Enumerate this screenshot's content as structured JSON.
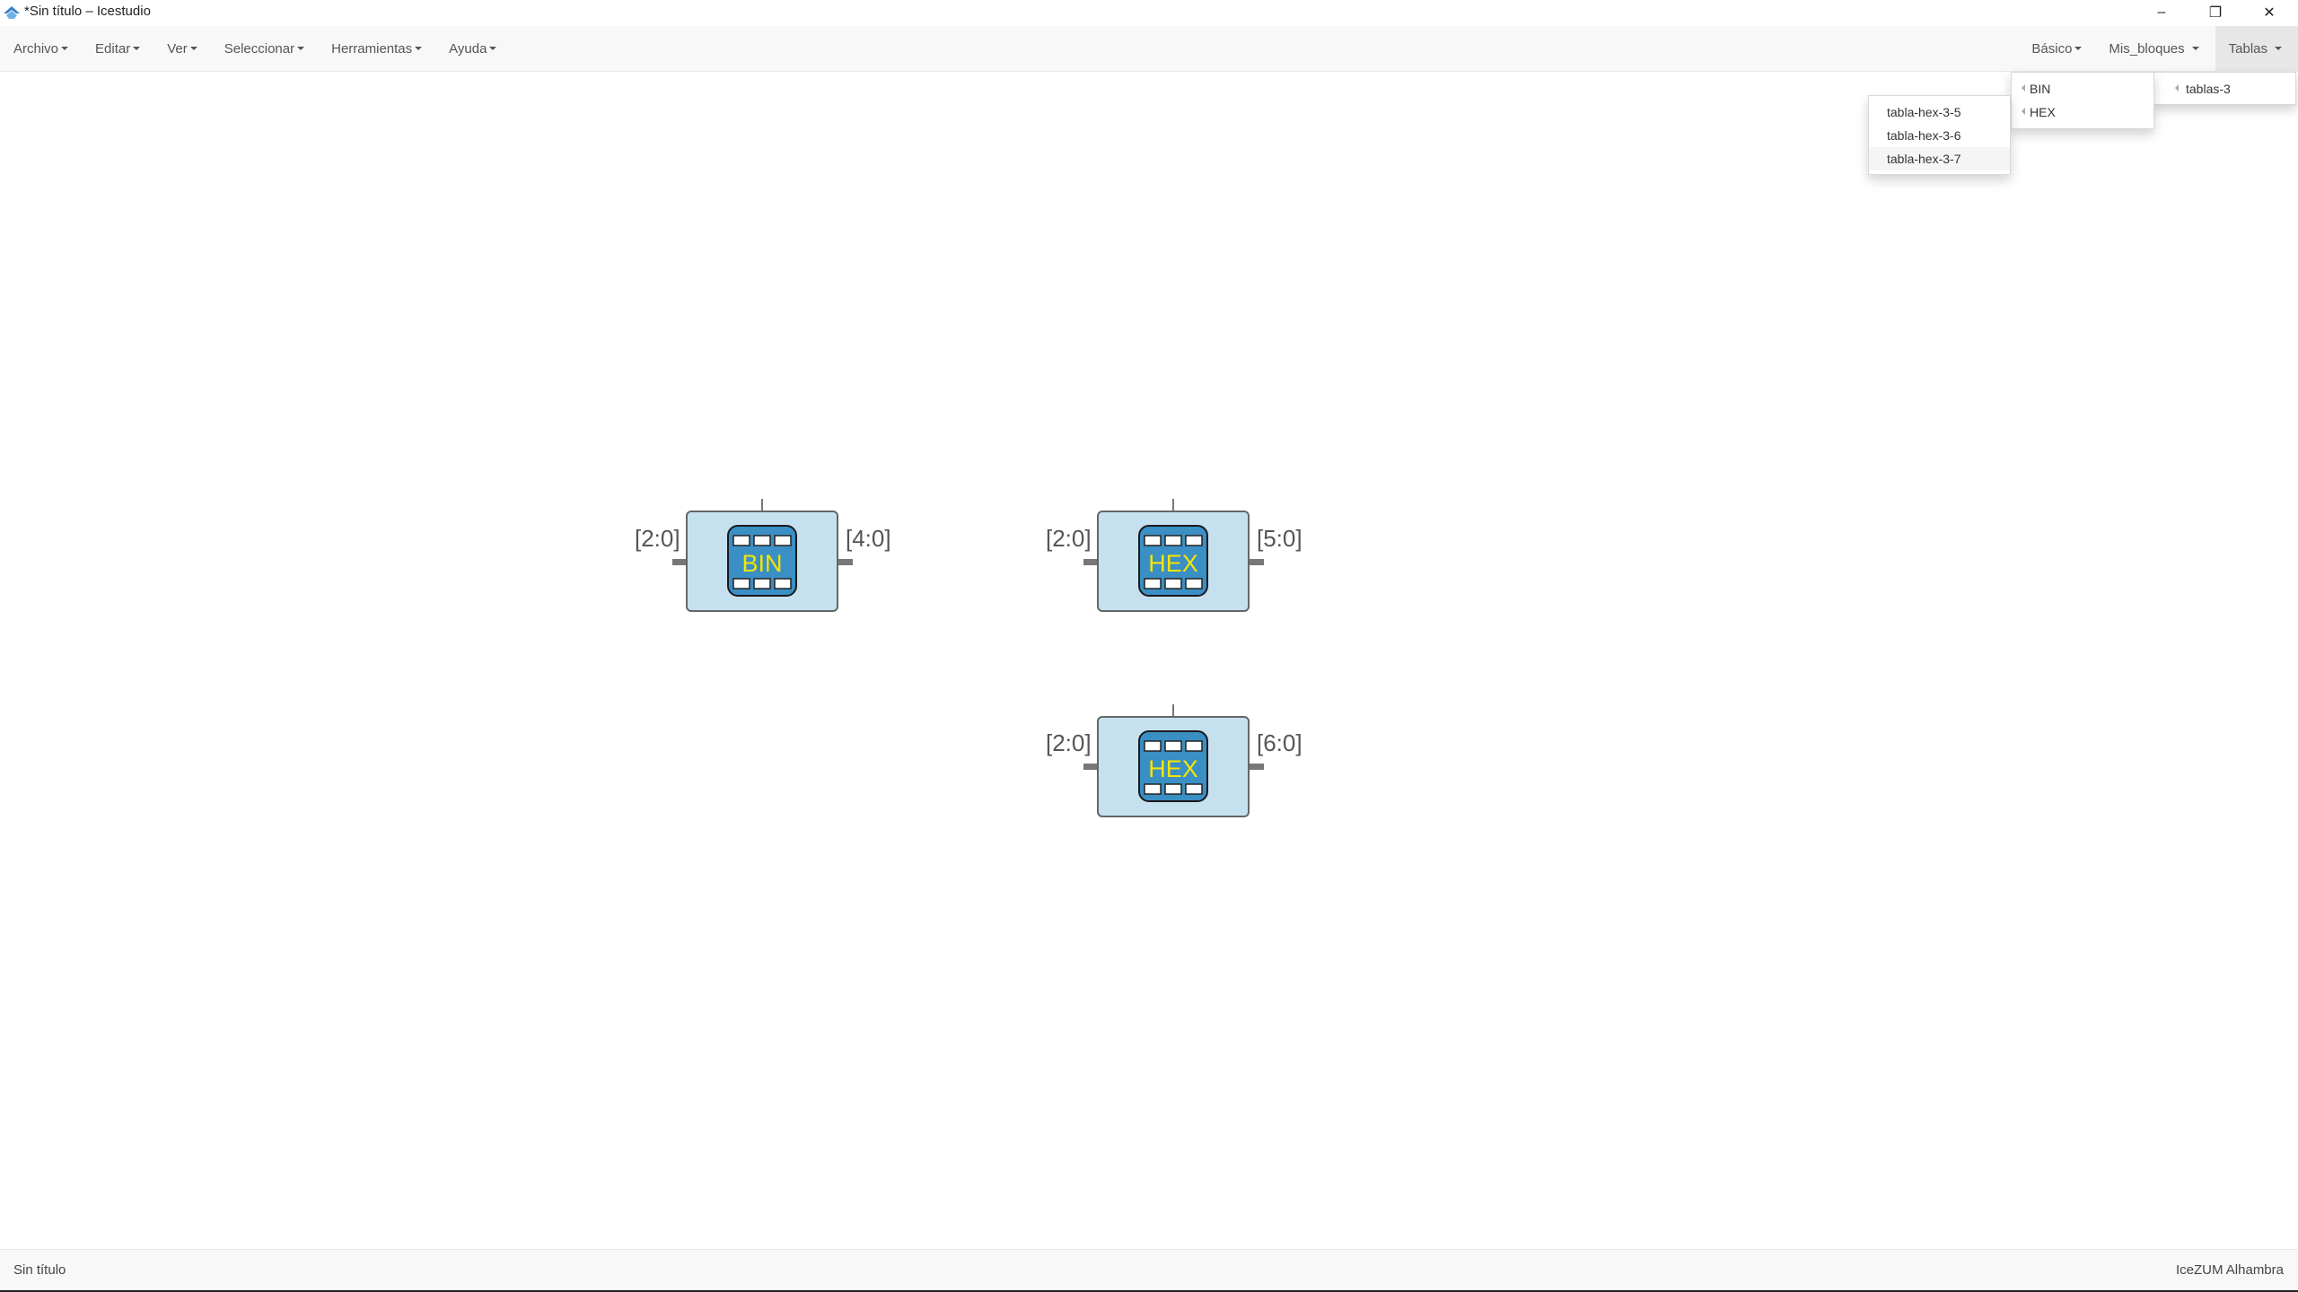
{
  "window": {
    "title": "*Sin título – Icestudio",
    "minimize_symbol": "–",
    "restore_symbol": "❐",
    "close_symbol": "✕"
  },
  "menubar": {
    "left": [
      "Archivo",
      "Editar",
      "Ver",
      "Seleccionar",
      "Herramientas",
      "Ayuda"
    ],
    "right": [
      "Básico",
      "Mis_bloques",
      "Tablas"
    ]
  },
  "dropdowns": {
    "tablas": [
      "tablas-3"
    ],
    "tablas_3": [
      "BIN",
      "HEX"
    ],
    "hex": [
      "tabla-hex-3-5",
      "tabla-hex-3-6",
      "tabla-hex-3-7"
    ]
  },
  "blocks": [
    {
      "icon_label": "BIN",
      "input_label": "[2:0]",
      "output_label": "[4:0]"
    },
    {
      "icon_label": "HEX",
      "input_label": "[2:0]",
      "output_label": "[5:0]"
    },
    {
      "icon_label": "HEX",
      "input_label": "[2:0]",
      "output_label": "[6:0]"
    }
  ],
  "statusbar": {
    "left": "Sin título",
    "right": "IceZUM Alhambra"
  },
  "colors": {
    "block_fill": "#c5e1f0",
    "icon_fill": "#3a8fc4",
    "icon_text": "#f5e500"
  }
}
